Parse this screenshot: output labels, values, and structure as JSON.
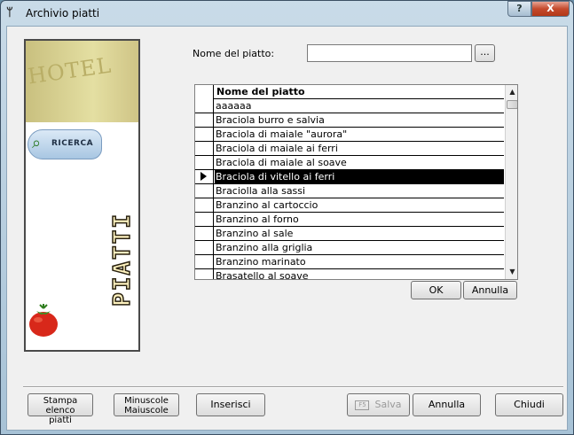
{
  "window": {
    "title": "Archivio piatti",
    "help_label": "?",
    "close_label": "X"
  },
  "side_panel": {
    "hotel_text": "HOTEL",
    "search_label": "RICERCA",
    "vertical_title": "PIATTI"
  },
  "search": {
    "label": "Nome del piatto:",
    "value": "",
    "browse_label": "..."
  },
  "grid": {
    "header": "Nome del piatto",
    "rows": [
      "aaaaaa",
      "Braciola burro e salvia",
      "Braciola di maiale \"aurora\"",
      "Braciola di maiale ai ferri",
      "Braciola di maiale al soave",
      "Braciola di vitello ai ferri",
      "Braciolla alla sassi",
      "Branzino al cartoccio",
      "Branzino al forno",
      "Branzino al sale",
      "Branzino alla griglia",
      "Branzino marinato",
      "Brasatello al soave"
    ],
    "selected_index": 5
  },
  "dialog_buttons": {
    "ok": "OK",
    "cancel": "Annulla"
  },
  "bottom_buttons": {
    "print_line1": "Stampa elenco",
    "print_line2": "piatti",
    "case_line1": "Minuscole",
    "case_line2": "Maiuscole",
    "insert": "Inserisci",
    "save_key": "F5",
    "save": "Salva",
    "cancel": "Annulla",
    "close": "Chiudi"
  },
  "colors": {
    "selection_bg": "#000000",
    "selection_fg": "#ffffff",
    "close_button": "#c44a2d"
  },
  "icons": {
    "app": "fork-knife-icon",
    "search": "magnifier-icon",
    "row_selected": "triangle-right-icon",
    "scroll_up": "arrow-up-icon",
    "scroll_down": "arrow-down-icon"
  }
}
